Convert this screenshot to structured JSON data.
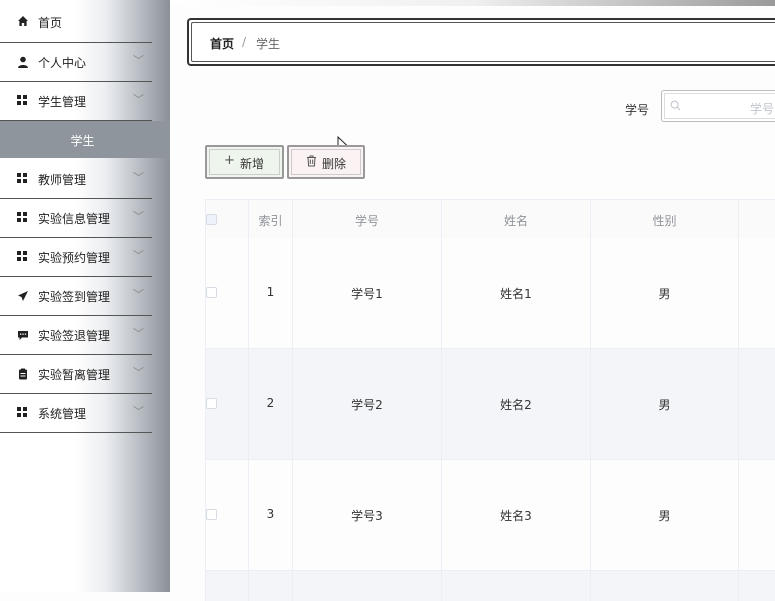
{
  "sidebar": {
    "items": [
      {
        "label": "首页",
        "icon": "home-icon"
      },
      {
        "label": "个人中心",
        "icon": "user-icon"
      },
      {
        "label": "学生管理",
        "icon": "grid-icon"
      },
      {
        "label": "教师管理",
        "icon": "grid-icon"
      },
      {
        "label": "实验信息管理",
        "icon": "grid-icon"
      },
      {
        "label": "实验预约管理",
        "icon": "grid-icon"
      },
      {
        "label": "实验签到管理",
        "icon": "send-icon"
      },
      {
        "label": "实验签退管理",
        "icon": "message-icon"
      },
      {
        "label": "实验暂离管理",
        "icon": "clipboard-icon"
      },
      {
        "label": "系统管理",
        "icon": "grid-icon"
      }
    ],
    "active_sub": "学生"
  },
  "breadcrumb": {
    "home": "首页",
    "sep": "/",
    "current": "学生"
  },
  "search": {
    "label": "学号",
    "placeholder": "学号"
  },
  "toolbar": {
    "add_label": "新增",
    "delete_label": "删除"
  },
  "table": {
    "columns": [
      "索引",
      "学号",
      "姓名",
      "性别"
    ],
    "rows": [
      {
        "index": "1",
        "student_no": "学号1",
        "name": "姓名1",
        "gender": "男"
      },
      {
        "index": "2",
        "student_no": "学号2",
        "name": "姓名2",
        "gender": "男"
      },
      {
        "index": "3",
        "student_no": "学号3",
        "name": "姓名3",
        "gender": "男"
      }
    ]
  },
  "colors": {
    "active_sub_bg": "#8f959c",
    "add_button_bg": "#eef5ec",
    "delete_button_bg": "#fbf3f3",
    "striped_row_bg": "#f4f5f8"
  }
}
